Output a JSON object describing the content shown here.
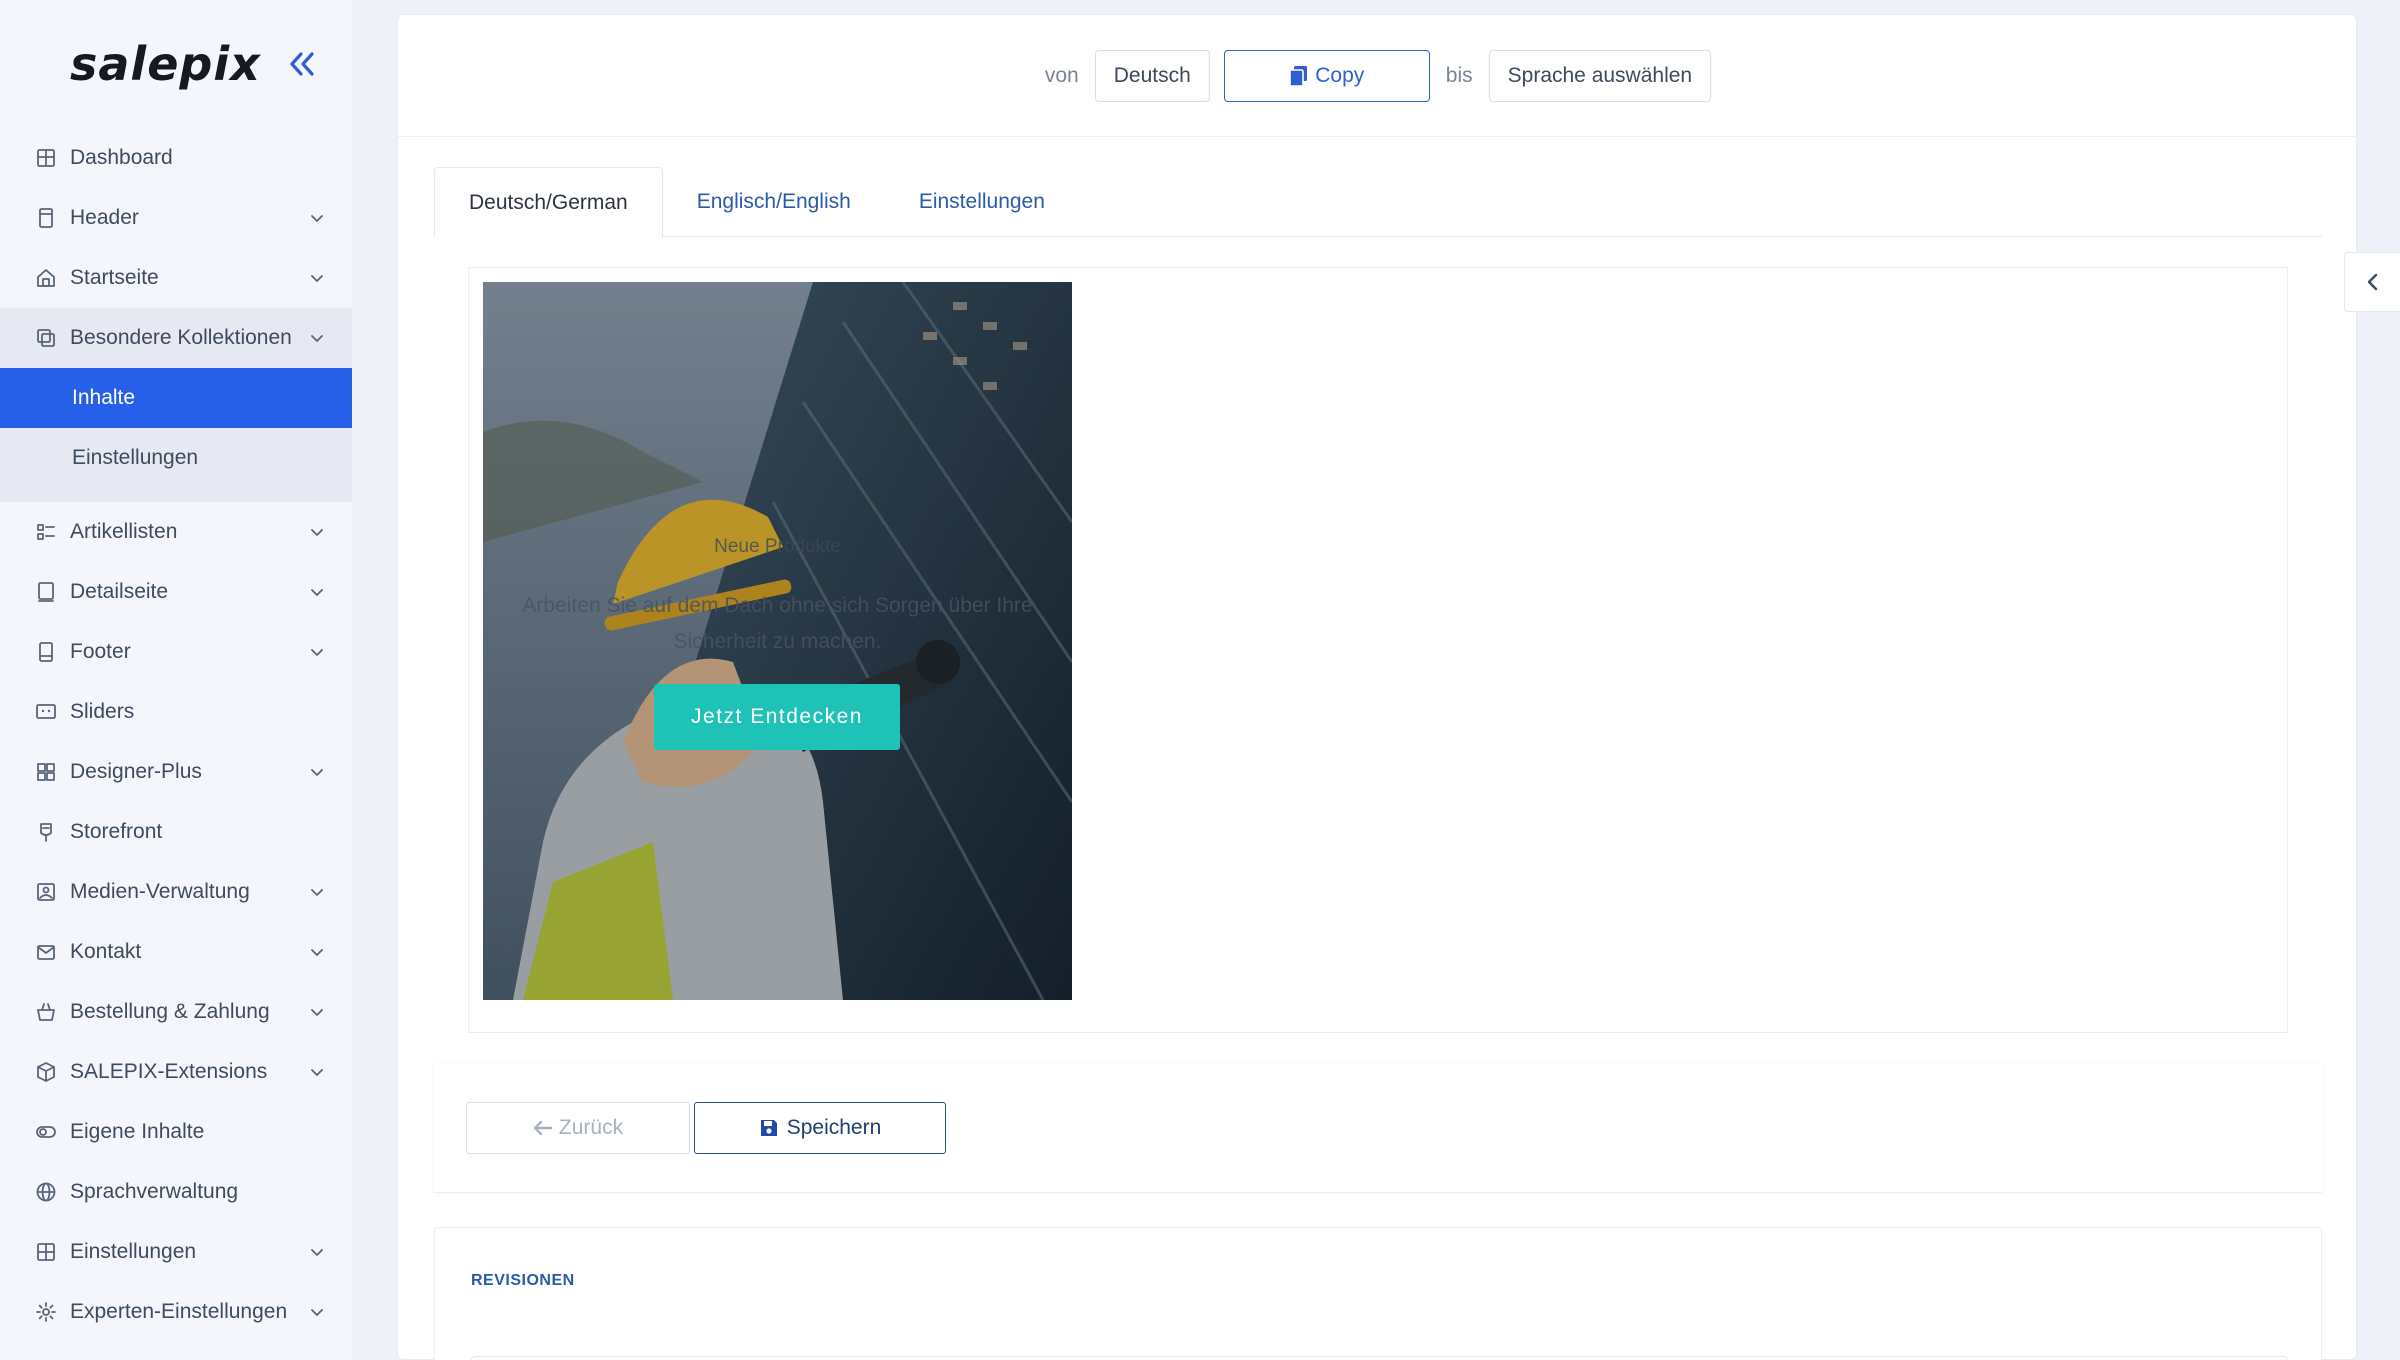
{
  "brand": {
    "logo": "salepix"
  },
  "sidebar": {
    "items": [
      {
        "label": "Dashboard",
        "icon": "dashboard-icon",
        "chevron": false
      },
      {
        "label": "Header",
        "icon": "header-icon",
        "chevron": true
      },
      {
        "label": "Startseite",
        "icon": "home-icon",
        "chevron": true
      },
      {
        "label": "Besondere Kollektionen",
        "icon": "collections-icon",
        "chevron": true,
        "expanded": true,
        "children": [
          {
            "label": "Inhalte",
            "active": true
          },
          {
            "label": "Einstellungen",
            "active": false
          }
        ]
      },
      {
        "label": "Artikellisten",
        "icon": "list-icon",
        "chevron": true
      },
      {
        "label": "Detailseite",
        "icon": "detail-icon",
        "chevron": true
      },
      {
        "label": "Footer",
        "icon": "footer-icon",
        "chevron": true
      },
      {
        "label": "Sliders",
        "icon": "slider-icon",
        "chevron": false
      },
      {
        "label": "Designer-Plus",
        "icon": "designer-icon",
        "chevron": true
      },
      {
        "label": "Storefront",
        "icon": "storefront-icon",
        "chevron": false
      },
      {
        "label": "Medien-Verwaltung",
        "icon": "media-icon",
        "chevron": true
      },
      {
        "label": "Kontakt",
        "icon": "contact-icon",
        "chevron": true
      },
      {
        "label": "Bestellung & Zahlung",
        "icon": "basket-icon",
        "chevron": true
      },
      {
        "label": "SALEPIX-Extensions",
        "icon": "extension-icon",
        "chevron": true
      },
      {
        "label": "Eigene Inhalte",
        "icon": "toggle-icon",
        "chevron": false
      },
      {
        "label": "Sprachverwaltung",
        "icon": "globe-icon",
        "chevron": false
      },
      {
        "label": "Einstellungen",
        "icon": "settings-grid-icon",
        "chevron": true
      },
      {
        "label": "Experten-Einstellungen",
        "icon": "gear-icon",
        "chevron": true
      }
    ]
  },
  "lang_bar": {
    "from_label": "von",
    "from_value": "Deutsch",
    "copy_label": "Copy",
    "to_label": "bis",
    "to_value": "Sprache auswählen"
  },
  "tabs": [
    {
      "label": "Deutsch/German",
      "active": true
    },
    {
      "label": "Englisch/English",
      "active": false
    },
    {
      "label": "Einstellungen",
      "active": false
    }
  ],
  "banner": {
    "title": "Neue Produkte",
    "text": "Arbeiten Sie auf dem Dach ohne sich Sorgen über Ihre Sicherheit zu machen.",
    "button_label": "Jetzt Entdecken"
  },
  "actions": {
    "back_label": "Zurück",
    "save_label": "Speichern"
  },
  "revisions": {
    "title": "REVISIONEN"
  },
  "colors": {
    "accent": "#2660e8",
    "teal": "#1ec2b6",
    "link": "#2a5ba8"
  }
}
